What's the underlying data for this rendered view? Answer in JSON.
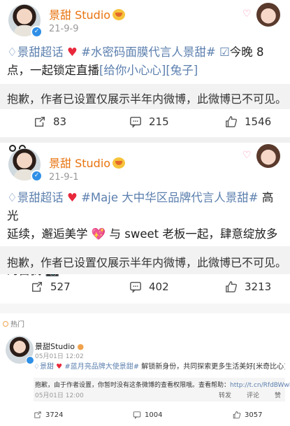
{
  "posts": [
    {
      "name": "景甜 Studio",
      "date": "21-9-9",
      "content_parts": {
        "topic": "超话",
        "topic_prefix": "景甜",
        "tag": "#水密码面膜代言人景甜#",
        "text1": "今晚 8",
        "text2": "点，一起锁定直播",
        "bracket": "[给你小心心][兔子]"
      },
      "notice": "抱歉，作者已设置仅展示半年内微博，此微博已不可见。",
      "reposts": "83",
      "comments": "215",
      "likes": "1546"
    },
    {
      "name": "景甜 Studio",
      "date": "21-9-1",
      "content_parts": {
        "topic_prefix": "景甜",
        "topic": "超话",
        "tag": "#Maje 大中华区品牌代言人景甜#",
        "text1": "高光",
        "text2": "延续，邂逅美学",
        "text3": "与 sweet 老板一起，肆意绽放多面",
        "text4": "的自我"
      },
      "notice": "抱歉，作者已设置仅展示半年内微博，此微博已不可见。",
      "reposts": "527",
      "comments": "402",
      "likes": "3213"
    }
  ],
  "hot": {
    "label": "热门",
    "name": "景甜Studio",
    "date": "05月01日 12:02",
    "content": {
      "topic": "景甜",
      "tag": "#蓝月亮品牌大使景甜#",
      "text": "解锁新身份，共同探索更多生活美好[米奇比心]"
    },
    "notice": "抱歉，由于作者设置，你暂时没有这条微博的查看权限哦。查看帮助：",
    "link": "http://t.cn/RfdBWwP",
    "notice_date": "05月01日 12:00",
    "sub_actions": [
      "转发",
      "评论",
      "赞"
    ],
    "reposts": "3724",
    "comments": "1004",
    "likes": "3057"
  }
}
